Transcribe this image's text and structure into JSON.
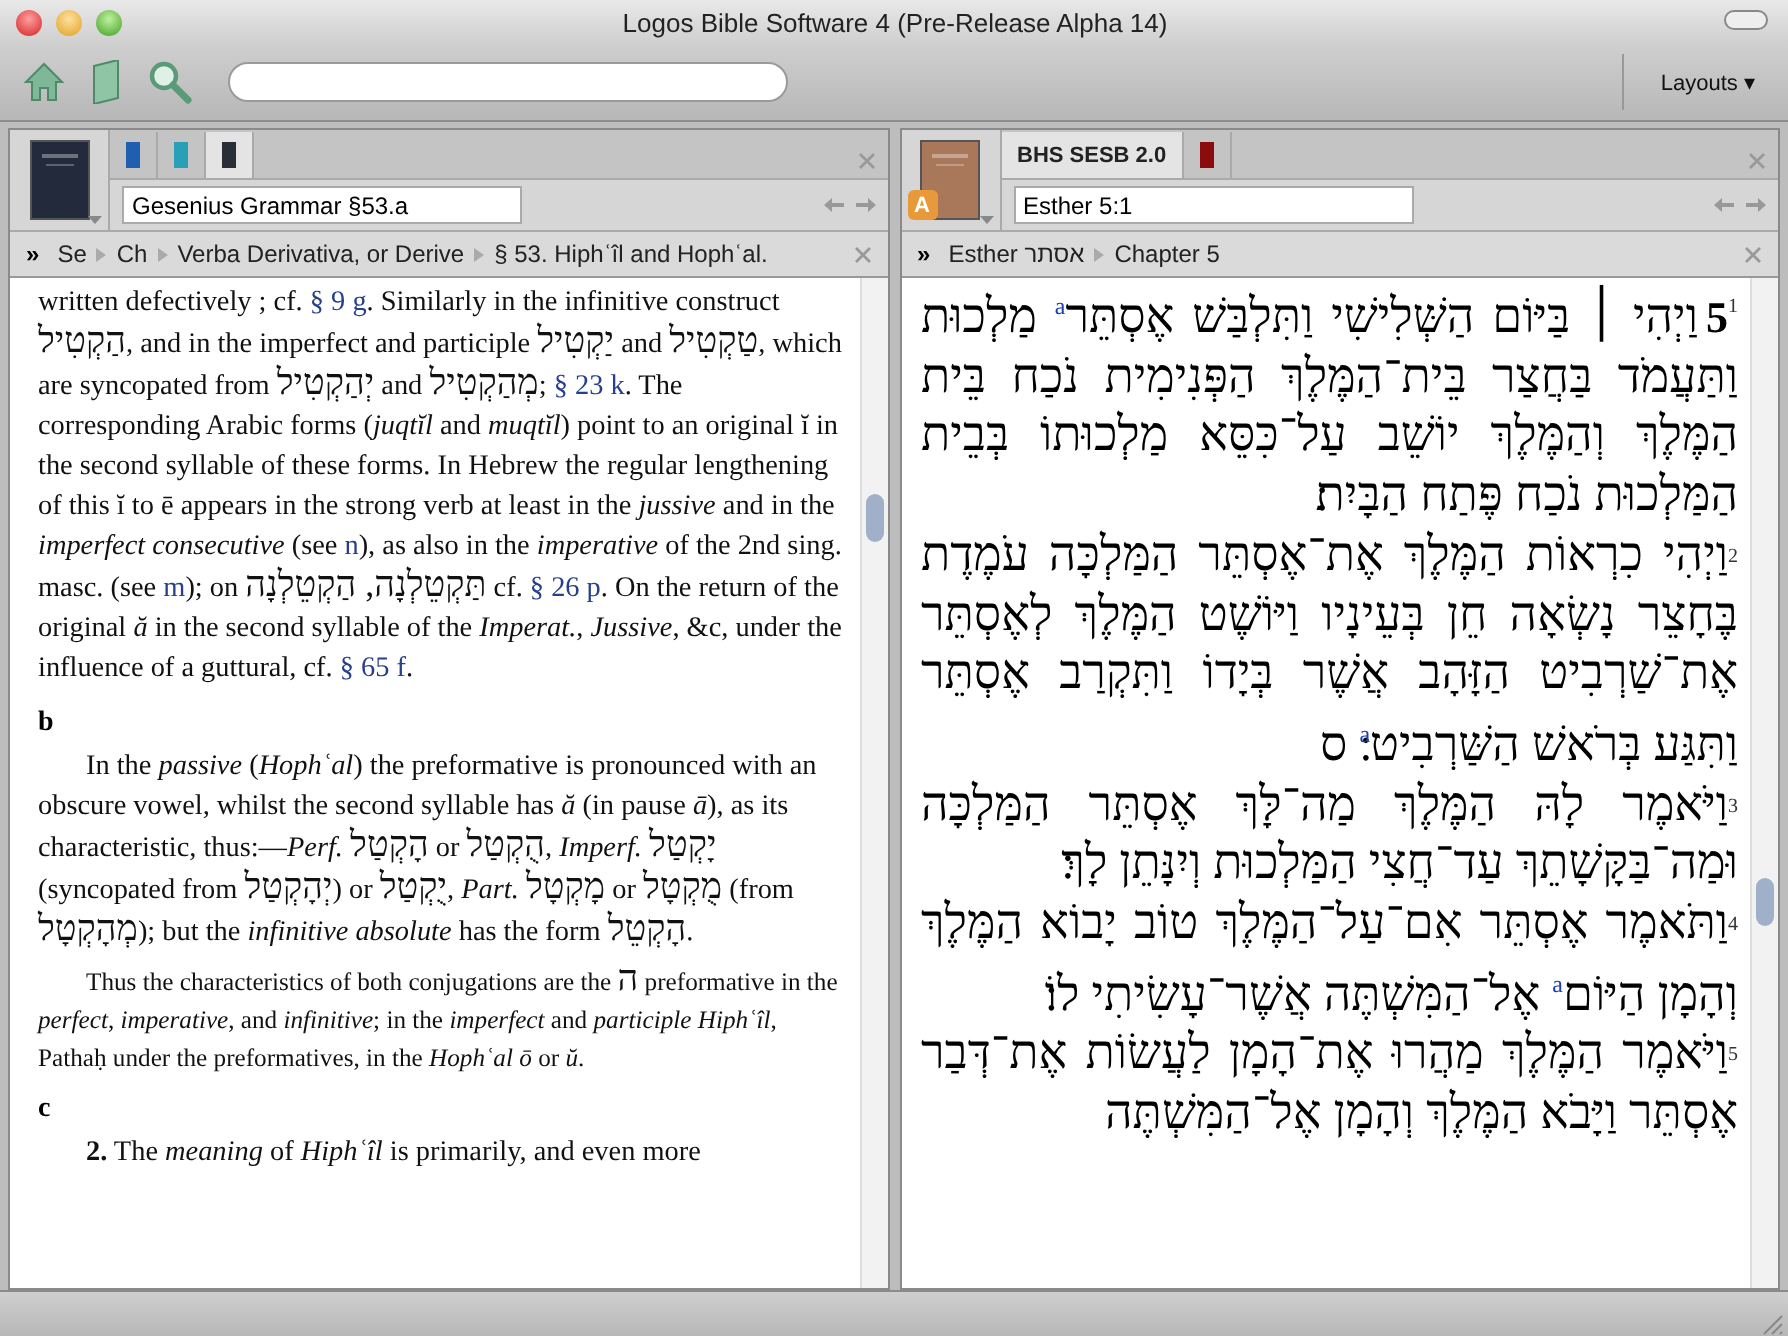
{
  "window": {
    "title": "Logos Bible Software 4 (Pre-Release Alpha 14)"
  },
  "toolbar": {
    "layouts_button": "Layouts ▾"
  },
  "panels": [
    {
      "kind": "grammar",
      "tabs": [
        {
          "kind": "book",
          "color": "#1f5fb0",
          "selected": false
        },
        {
          "kind": "book",
          "color": "#2aa0b8",
          "selected": false
        },
        {
          "kind": "book",
          "color": "#2a2e36",
          "selected": true
        }
      ],
      "location": "Gesenius Grammar §53.a",
      "breadcrumb_chevron": "»",
      "breadcrumbs": [
        "Se",
        "Ch",
        "Verba Derivativa, or Derive",
        "§ 53. Hiphʿîl and Hophʿal."
      ],
      "blocks": [
        {
          "kind": "continuation",
          "segments": [
            {
              "kind": "text",
              "text": "written defectively ; cf. "
            },
            {
              "kind": "link",
              "text": "§ 9 g"
            },
            {
              "kind": "text",
              "text": ". Similarly in the infinitive construct "
            },
            {
              "kind": "hebrew",
              "text": "הַקְטִיל"
            },
            {
              "kind": "text",
              "text": ", and in the imperfect and participle "
            },
            {
              "kind": "hebrew",
              "text": "יַקְטִיל"
            },
            {
              "kind": "text",
              "text": " and "
            },
            {
              "kind": "hebrew",
              "text": "טַקְטִיל"
            },
            {
              "kind": "text",
              "text": ", which are syncopated from "
            },
            {
              "kind": "hebrew",
              "text": "יְהַקְטִיל"
            },
            {
              "kind": "text",
              "text": " and "
            },
            {
              "kind": "hebrew",
              "text": "מְהַקְטִיל"
            },
            {
              "kind": "text",
              "text": "; "
            },
            {
              "kind": "link",
              "text": "§ 23 k"
            },
            {
              "kind": "text",
              "text": ". The corresponding Arabic forms (*juqtĭl* and *muqtĭl*) point to an original ĭ in the second syllable of these forms. In Hebrew the regular lengthening of this ĭ to ē appears in the strong verb at least in the *jussive* and in the *imperfect consecutive* (see "
            },
            {
              "kind": "link",
              "text": "n"
            },
            {
              "kind": "text",
              "text": "), as also in the *imperative* of the 2nd sing. masc. (see "
            },
            {
              "kind": "link",
              "text": "m"
            },
            {
              "kind": "text",
              "text": "); on "
            },
            {
              "kind": "hebrew",
              "text": "תַּקְטֵלְנָה, הַקְטֵלְנָה"
            },
            {
              "kind": "text",
              "text": " cf. "
            },
            {
              "kind": "link",
              "text": "§ 26 p"
            },
            {
              "kind": "text",
              "text": ". On the return of the original *ă* in the second syllable of the *Imperat.*, *Jussive*, &c, under the influence of a guttural, cf. "
            },
            {
              "kind": "link",
              "text": "§ 65 f"
            },
            {
              "kind": "text",
              "text": "."
            }
          ]
        },
        {
          "kind": "heading",
          "text": "b"
        },
        {
          "kind": "paragraph",
          "segments": [
            {
              "kind": "text",
              "text": "In the *passive* (*Hophʿal*) the preformative is pronounced with an obscure vowel, whilst the second syllable has *ă* (in pause *ā*), as its characteristic, thus:—*Perf.* "
            },
            {
              "kind": "hebrew",
              "text": "הָקְטַל"
            },
            {
              "kind": "text",
              "text": " or "
            },
            {
              "kind": "hebrew",
              "text": "הֻקְטַל"
            },
            {
              "kind": "text",
              "text": ", *Imperf.* "
            },
            {
              "kind": "hebrew",
              "text": "יָקְטַל"
            },
            {
              "kind": "text",
              "text": " (syncopated from "
            },
            {
              "kind": "hebrew",
              "text": "יְהָקְטַל"
            },
            {
              "kind": "text",
              "text": ") or "
            },
            {
              "kind": "hebrew",
              "text": "יֻקְטַל"
            },
            {
              "kind": "text",
              "text": ", *Part.* "
            },
            {
              "kind": "hebrew",
              "text": "מָקְטָל"
            },
            {
              "kind": "text",
              "text": " or "
            },
            {
              "kind": "hebrew",
              "text": "מֻקְטָל"
            },
            {
              "kind": "text",
              "text": " (from "
            },
            {
              "kind": "hebrew",
              "text": "מְהָקְטָל"
            },
            {
              "kind": "text",
              "text": "); but the *infinitive absolute* has the form "
            },
            {
              "kind": "hebrew",
              "text": "הָקְטֵל"
            },
            {
              "kind": "text",
              "text": "."
            }
          ]
        },
        {
          "kind": "small",
          "segments": [
            {
              "kind": "text",
              "text": "Thus the characteristics of both conjugations are the "
            },
            {
              "kind": "hebrew",
              "text": "ה"
            },
            {
              "kind": "text",
              "text": " preformative in the *perfect*, *imperative*, and *infinitive*; in the *imperfect* and *participle Hiphʿîl*, Pathaḥ under the preformatives, in the *Hophʿal ō* or *ŭ*."
            }
          ]
        },
        {
          "kind": "heading",
          "text": "c"
        },
        {
          "kind": "paragraph",
          "segments": [
            {
              "kind": "text",
              "text": "**2.** The *meaning* of *Hiphʿîl* is primarily, and even more"
            }
          ]
        }
      ]
    },
    {
      "kind": "bible",
      "badge": "A",
      "tabs": [
        {
          "kind": "label",
          "label": "BHS SESB 2.0",
          "selected": true
        },
        {
          "kind": "book",
          "color": "#8a0c0c",
          "selected": false
        }
      ],
      "location": "Esther 5:1",
      "breadcrumb_chevron": "»",
      "breadcrumbs": [
        "Esther אסתר",
        "Chapter 5"
      ],
      "chapter": "5",
      "verses": [
        {
          "number": "1",
          "text": "וַיְהִי ׀ בַּיּוֹם הַשְּׁלִישִׁי וַתִּלְבַּשׁ אֶסְתֵּר$^{a}$ מַלְכוּת וַתַּעֲמֹד בַּחֲצַר בֵּית־הַמֶּלֶךְ הַפְּנִימִית נֹכַח בֵּית הַמֶּלֶךְ וְהַמֶּלֶךְ יוֹשֵׁב עַל־כִּסֵּא מַלְכוּתוֹ בְּבֵית הַמַּלְכוּת נֹכַח פֶּתַח הַבָּיִת׃"
        },
        {
          "number": "2",
          "text": "וַיְהִי כִרְאוֹת הַמֶּלֶךְ אֶת־אֶסְתֵּר הַמַּלְכָּה עֹמֶדֶת בֶּחָצֵר נָשְׂאָה חֵן בְּעֵינָיו וַיּוֹשֶׁט הַמֶּלֶךְ לְאֶסְתֵּר אֶת־שַׁרְבִיט הַזָּהָב אֲשֶׁר בְּיָדוֹ וַתִּקְרַב אֶסְתֵּר וַתִּגַּע בְּרֹאשׁ הַשַּׁרְבִיט$^{a}$׃ ס"
        },
        {
          "number": "3",
          "text": "וַיֹּאמֶר לָהּ הַמֶּלֶךְ מַה־לָּךְ אֶסְתֵּר הַמַּלְכָּה וּמַה־בַּקָּשָׁתֵךְ עַד־חֲצִי הַמַּלְכוּת וְיִנָּתֵן לָךְ׃"
        },
        {
          "number": "4",
          "text": "וַתֹּאמֶר אֶסְתֵּר אִם־עַל־הַמֶּלֶךְ טוֹב יָבוֹא הַמֶּלֶךְ וְהָמָן הַיּוֹם$^{a}$ אֶל־הַמִּשְׁתֶּה אֲשֶׁר־עָשִׂיתִי לוֹ׃"
        },
        {
          "number": "5",
          "text": "וַיֹּאמֶר הַמֶּלֶךְ מַהֲרוּ אֶת־הָמָן לַעֲשׂוֹת אֶת־דְּבַר אֶסְתֵּר וַיָּבֹא הַמֶּלֶךְ וְהָמָן אֶל־הַמִּשְׁתֶּה"
        }
      ]
    }
  ]
}
